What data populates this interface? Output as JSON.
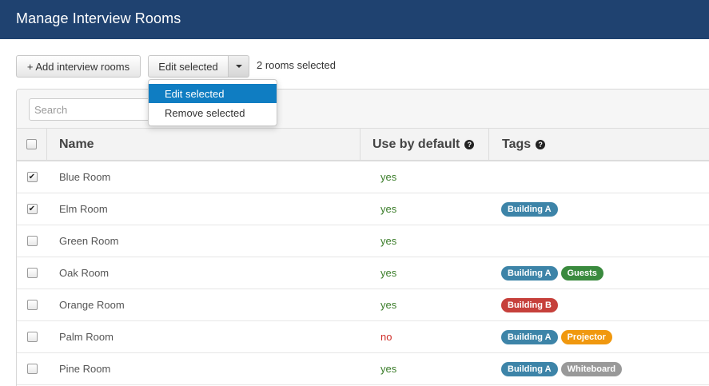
{
  "header": {
    "title": "Manage Interview Rooms"
  },
  "toolbar": {
    "add_label": "+ Add interview rooms",
    "edit_label": "Edit selected",
    "selection_text": "2 rooms selected"
  },
  "dropdown": {
    "items": [
      {
        "label": "Edit selected",
        "active": true
      },
      {
        "label": "Remove selected",
        "active": false
      }
    ]
  },
  "search": {
    "placeholder": "Search"
  },
  "table": {
    "columns": {
      "name": "Name",
      "default": "Use by default",
      "tags": "Tags"
    },
    "rows": [
      {
        "name": "Blue Room",
        "checked": true,
        "default": "yes",
        "tags": []
      },
      {
        "name": "Elm Room",
        "checked": true,
        "default": "yes",
        "tags": [
          "Building A"
        ]
      },
      {
        "name": "Green Room",
        "checked": false,
        "default": "yes",
        "tags": []
      },
      {
        "name": "Oak Room",
        "checked": false,
        "default": "yes",
        "tags": [
          "Building A",
          "Guests"
        ]
      },
      {
        "name": "Orange Room",
        "checked": false,
        "default": "yes",
        "tags": [
          "Building B"
        ]
      },
      {
        "name": "Palm Room",
        "checked": false,
        "default": "no",
        "tags": [
          "Building A",
          "Projector"
        ]
      },
      {
        "name": "Pine Room",
        "checked": false,
        "default": "yes",
        "tags": [
          "Building A",
          "Whiteboard"
        ]
      }
    ]
  },
  "tag_colors": {
    "Building A": "#3d84a8",
    "Building B": "#c6403b",
    "Guests": "#3a8a3e",
    "Projector": "#f0980f",
    "Whiteboard": "#999999"
  },
  "colors": {
    "header_bg": "#1f4270",
    "accent": "#0f7dc2",
    "yes": "#3b7d2a",
    "no": "#d0302b"
  }
}
